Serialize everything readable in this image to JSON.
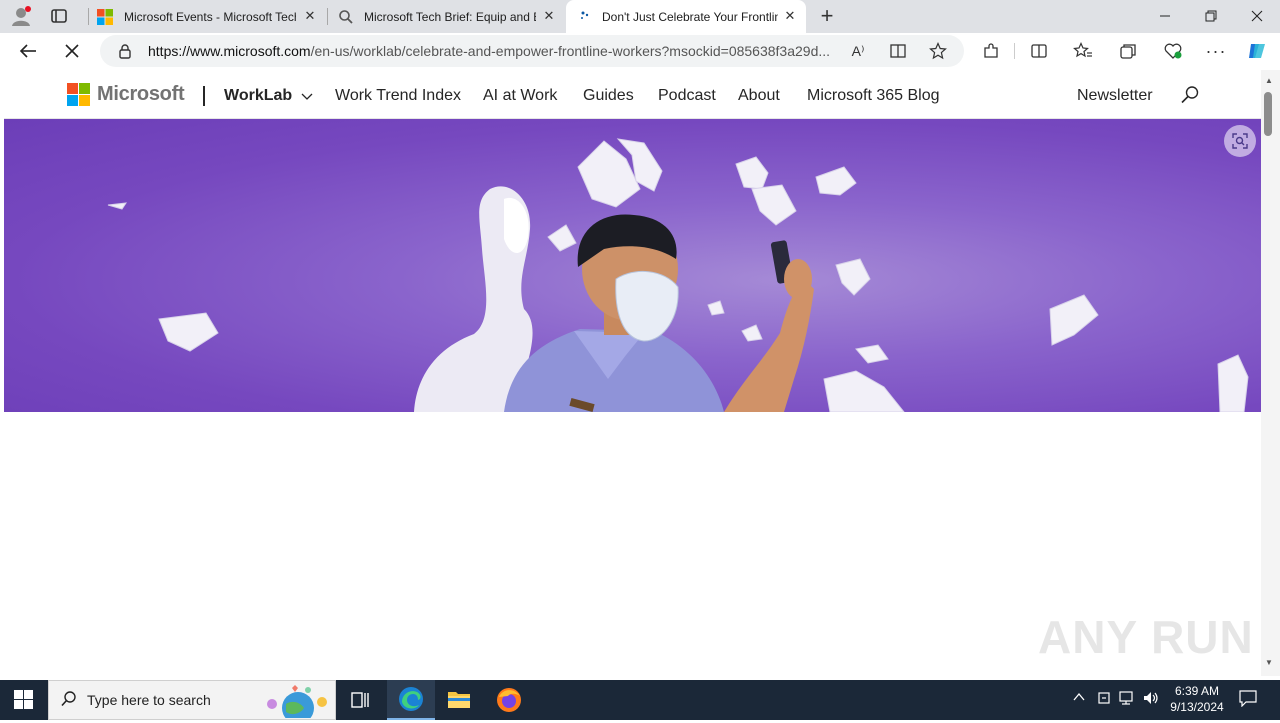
{
  "browser": {
    "tabs": [
      {
        "title": "Microsoft Events - Microsoft Tech",
        "favicon": "microsoft-logo-icon"
      },
      {
        "title": "Microsoft Tech Brief: Equip and E",
        "favicon": "search-icon"
      },
      {
        "title": "Don't Just Celebrate Your Frontlin",
        "favicon": "loading-icon",
        "active": true
      }
    ],
    "url_host": "https://www.microsoft.com",
    "url_path": "/en-us/worklab/celebrate-and-empower-frontline-workers?msockid=085638f3a29d..."
  },
  "site": {
    "brand": "Microsoft",
    "section": "WorkLab",
    "nav": [
      "Work Trend Index",
      "AI at Work",
      "Guides",
      "Podcast",
      "About",
      "Microsoft 365 Blog"
    ],
    "newsletter": "Newsletter"
  },
  "taskbar": {
    "search_placeholder": "Type here to search",
    "time": "6:39 AM",
    "date": "9/13/2024"
  },
  "watermark": "ANY RUN",
  "colors": {
    "hero_purple": "#7648bf",
    "taskbar": "#1b2838",
    "accent": "#0078d4"
  }
}
